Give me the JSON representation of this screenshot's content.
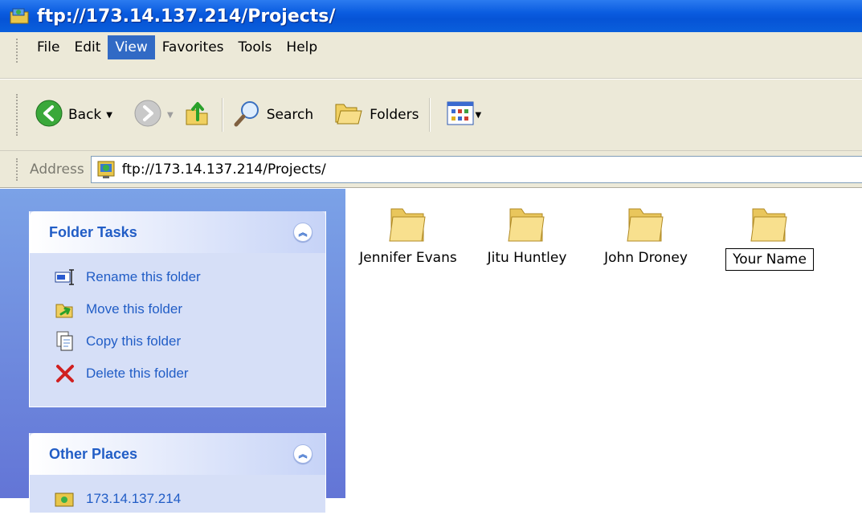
{
  "window": {
    "title": "ftp://173.14.137.214/Projects/"
  },
  "menubar": {
    "items": [
      "File",
      "Edit",
      "View",
      "Favorites",
      "Tools",
      "Help"
    ],
    "active": "View"
  },
  "toolbar": {
    "back_label": "Back",
    "search_label": "Search",
    "folders_label": "Folders"
  },
  "address": {
    "label": "Address",
    "value": "ftp://173.14.137.214/Projects/"
  },
  "folder_tasks": {
    "title": "Folder Tasks",
    "items": [
      "Rename this folder",
      "Move this folder",
      "Copy this folder",
      "Delete this folder"
    ]
  },
  "other_places": {
    "title": "Other Places",
    "first_item": "173.14.137.214"
  },
  "folders": [
    {
      "name": "Jennifer Evans",
      "selected": false
    },
    {
      "name": "Jitu Huntley",
      "selected": false
    },
    {
      "name": "John Droney",
      "selected": false
    },
    {
      "name": "Your Name",
      "selected": true
    }
  ],
  "colors": {
    "title_bar": "#0a5ce0",
    "task_link": "#215dc6",
    "menu_highlight": "#316ac5"
  },
  "icons": [
    "ftp-folder-icon",
    "back-arrow-icon",
    "forward-arrow-icon",
    "up-folder-icon",
    "search-magnifier-icon",
    "folders-icon",
    "views-icon",
    "rename-icon",
    "move-icon",
    "copy-icon",
    "delete-icon",
    "folder-icon"
  ]
}
